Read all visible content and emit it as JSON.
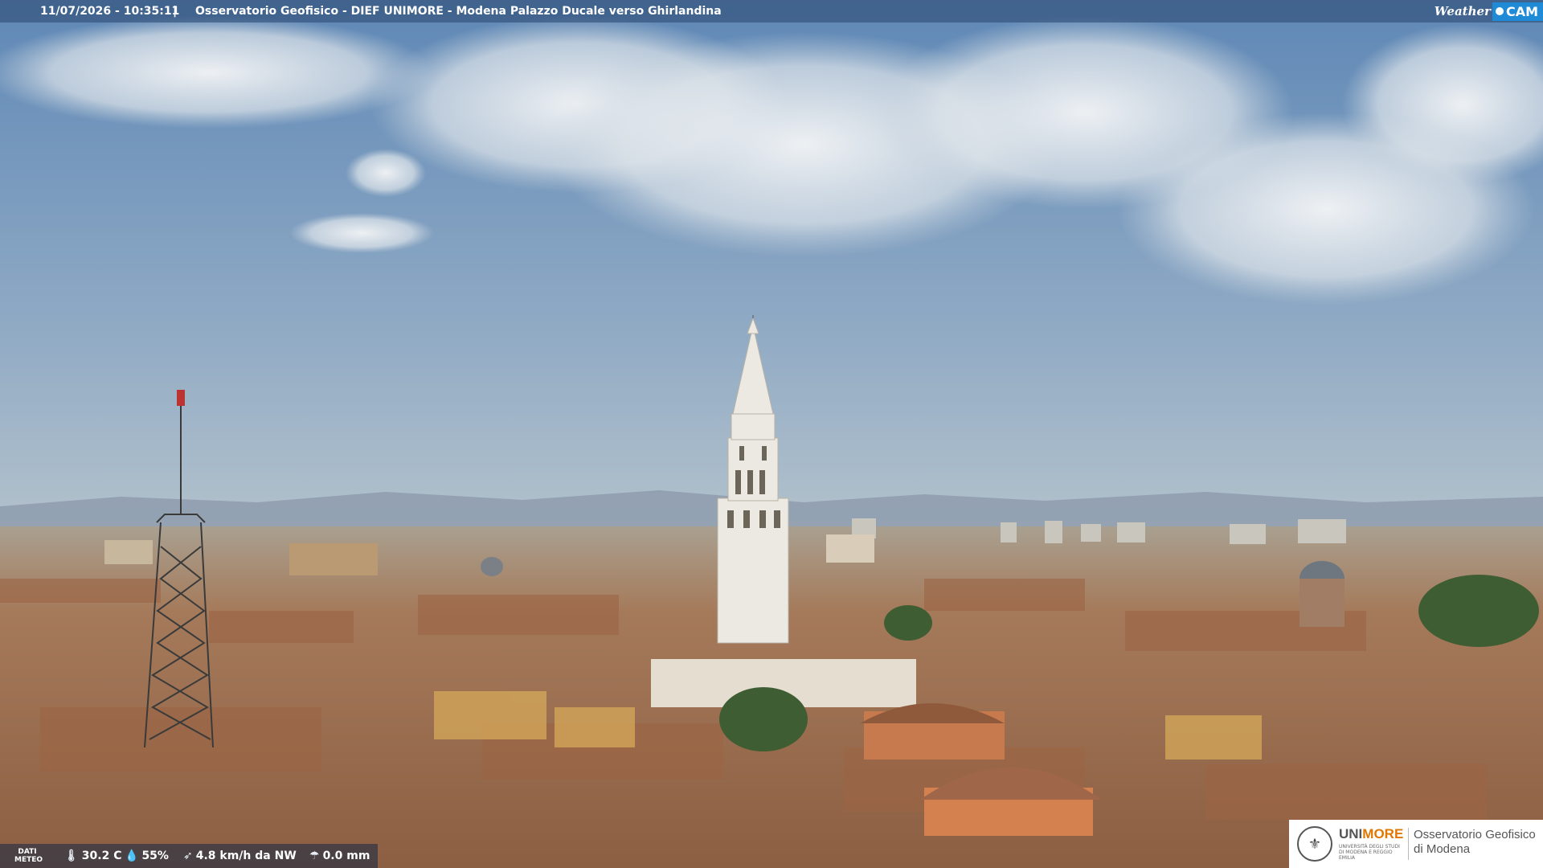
{
  "header": {
    "timestamp": "11/07/2026 - 10:35:11",
    "separator": "|",
    "title": "Osservatorio Geofisico - DIEF UNIMORE - Modena Palazzo Ducale verso Ghirlandina",
    "logo_weather": "Weather",
    "logo_cam": "CAM"
  },
  "weather": {
    "label": "DATI METEO",
    "temperature": "30.2 C",
    "humidity": "55%",
    "wind": "4.8 km/h da NW",
    "rain": "0.0 mm"
  },
  "branding": {
    "unimore_prefix": "UNI",
    "unimore_suffix": "MORE",
    "unimore_small": "UNIVERSITÀ DEGLI STUDI DI MODENA E REGGIO EMILIA",
    "observatory_line1": "Osservatorio Geofisico",
    "observatory_line2": "di Modena"
  },
  "colors": {
    "sky_top": "#6f93bb",
    "sky_bottom": "#a9bccc",
    "roofs": "#b07a55",
    "tower": "#e9e6df"
  }
}
